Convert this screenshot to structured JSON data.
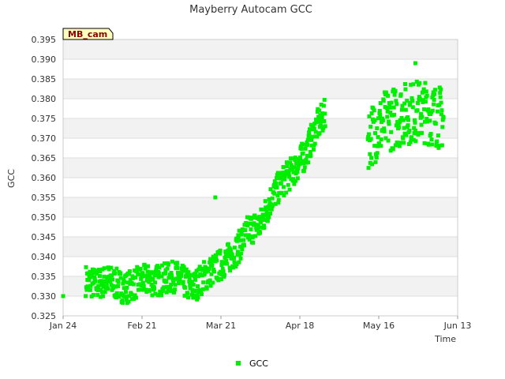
{
  "chart_data": {
    "type": "scatter",
    "title": "Mayberry Autocam GCC",
    "xlabel": "Time",
    "ylabel": "GCC",
    "site_badge": "MB_cam",
    "x_ticks": [
      "Jan 24",
      "Feb 21",
      "Mar 21",
      "Apr 18",
      "May 16",
      "Jun 13"
    ],
    "x_range_days": [
      0,
      140
    ],
    "ylim": [
      0.325,
      0.395
    ],
    "y_ticks": [
      "0.325",
      "0.330",
      "0.335",
      "0.340",
      "0.345",
      "0.350",
      "0.355",
      "0.360",
      "0.365",
      "0.370",
      "0.375",
      "0.380",
      "0.385",
      "0.390",
      "0.395"
    ],
    "grid": true,
    "legend": {
      "position": "bottom",
      "label": "GCC"
    },
    "series": [
      {
        "name": "GCC",
        "color": "#00ee00",
        "trend_day": [
          0,
          8,
          12,
          16,
          22,
          28,
          34,
          40,
          46,
          50,
          54,
          58,
          62,
          66,
          70,
          74,
          78,
          82,
          86,
          90,
          93,
          100,
          108,
          114,
          120,
          127,
          131,
          135
        ],
        "trend_gcc": [
          0.33,
          0.334,
          0.333,
          0.334,
          0.332,
          0.334,
          0.334,
          0.335,
          0.332,
          0.335,
          0.337,
          0.339,
          0.342,
          0.347,
          0.348,
          0.355,
          0.359,
          0.362,
          0.366,
          0.373,
          0.376,
          null,
          0.37,
          0.374,
          0.376,
          0.377,
          0.376,
          0.375
        ],
        "spread": 0.004,
        "points_per_day": 8,
        "gap_days": [
          93,
          107
        ],
        "isolated_points": [
          [
            0,
            0.33
          ],
          [
            54,
            0.355
          ],
          [
            125,
            0.389
          ]
        ]
      }
    ]
  }
}
